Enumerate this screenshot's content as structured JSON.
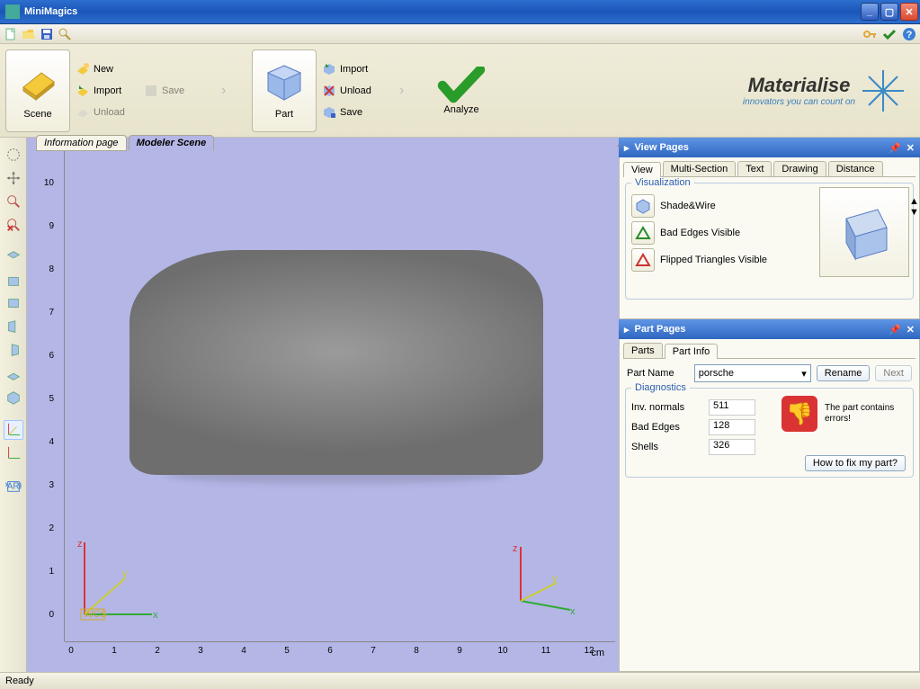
{
  "window": {
    "title": "MiniMagics"
  },
  "ribbon": {
    "scene": {
      "label": "Scene",
      "new": "New",
      "import": "Import",
      "unload": "Unload",
      "save": "Save"
    },
    "part": {
      "label": "Part",
      "import": "Import",
      "unload": "Unload",
      "save": "Save"
    },
    "analyze": {
      "label": "Analyze"
    }
  },
  "brand": {
    "name": "Materialise",
    "tagline": "innovators you can count on"
  },
  "main_tabs": {
    "info": "Information page",
    "scene": "Modeler Scene"
  },
  "ruler": {
    "unit": "cm",
    "y": [
      "10",
      "9",
      "8",
      "7",
      "6",
      "5",
      "4",
      "3",
      "2",
      "1",
      "0"
    ],
    "x": [
      "0",
      "1",
      "2",
      "3",
      "4",
      "5",
      "6",
      "7",
      "8",
      "9",
      "10",
      "11",
      "12"
    ],
    "wcs": "WCS"
  },
  "view_pages": {
    "title": "View Pages",
    "tabs": {
      "view": "View",
      "multi": "Multi-Section",
      "text": "Text",
      "drawing": "Drawing",
      "distance": "Distance"
    },
    "group": "Visualization",
    "shade": "Shade&Wire",
    "badedges": "Bad Edges Visible",
    "flipped": "Flipped Triangles Visible"
  },
  "part_pages": {
    "title": "Part Pages",
    "tabs": {
      "parts": "Parts",
      "info": "Part Info"
    },
    "name_label": "Part Name",
    "name_value": "porsche",
    "rename": "Rename",
    "next": "Next",
    "diag_group": "Diagnostics",
    "inv_normals": {
      "label": "Inv. normals",
      "value": "511"
    },
    "bad_edges": {
      "label": "Bad Edges",
      "value": "128"
    },
    "shells": {
      "label": "Shells",
      "value": "326"
    },
    "error_text": "The part contains errors!",
    "fix": "How to fix my part?"
  },
  "status": "Ready"
}
